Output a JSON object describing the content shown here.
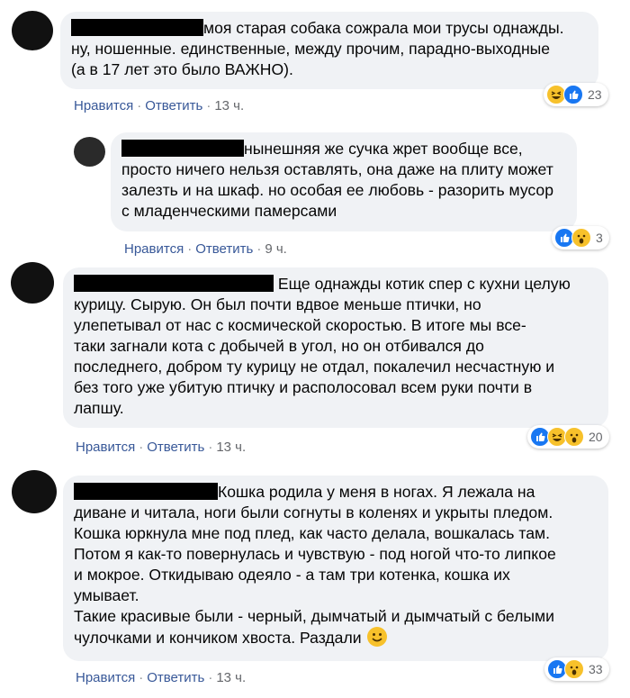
{
  "comments": [
    {
      "text_lines": [
        "моя старая собака сожрала мои трусы однажды.",
        "ну, ношенные. единственные, между прочим, парадно-выходные",
        "(а в 17 лет это было ВАЖНО)."
      ],
      "actions": {
        "like": "Нравится",
        "reply": "Ответить",
        "time": "13 ч."
      },
      "reactions": {
        "icons": [
          "haha-icon",
          "like-icon"
        ],
        "count": "23"
      }
    },
    {
      "text_lines": [
        "нынешняя же сучка жрет вообще все,",
        "просто ничего нельзя оставлять, она даже на плиту может",
        "залезть и на шкаф. но особая ее любовь - разорить мусор",
        "с младенческими памерсами"
      ],
      "actions": {
        "like": "Нравится",
        "reply": "Ответить",
        "time": "9 ч."
      },
      "reactions": {
        "icons": [
          "like-icon",
          "wow-icon"
        ],
        "count": "3"
      }
    },
    {
      "text_lines": [
        "Еще однажды котик спер с кухни целую",
        "курицу. Сырую. Он был почти вдвое меньше птички, но",
        "улепетывал от нас с космической скоростью. В итоге мы все-",
        "таки загнали кота с добычей в угол, но он отбивался до",
        "последнего, добром ту курицу не отдал, покалечил несчастную и",
        "без того уже убитую птичку и располосовал всем руки почти в",
        "лапшу."
      ],
      "actions": {
        "like": "Нравится",
        "reply": "Ответить",
        "time": "13 ч."
      },
      "reactions": {
        "icons": [
          "like-icon",
          "haha-icon",
          "wow-icon"
        ],
        "count": "20"
      }
    },
    {
      "text_lines": [
        "Кошка родила у меня в ногах. Я лежала на",
        "диване и читала, ноги были согнуты в коленях и укрыты пледом.",
        "Кошка юркнула мне под плед, как часто делала, вошкалась там.",
        "Потом я как-то повернулась и чувствую - под ногой что-то липкое",
        "и мокрое. Откидываю одеяло - а там три котенка, кошка их",
        "умывает.",
        "Такие красивые были - черный, дымчатый и дымчатый с белыми",
        "чулочками и кончиком хвоста. Раздали"
      ],
      "actions": {
        "like": "Нравится",
        "reply": "Ответить",
        "time": "13 ч."
      },
      "reactions": {
        "icons": [
          "like-icon",
          "wow-icon"
        ],
        "count": "33"
      }
    }
  ],
  "colors": {
    "bubble": "#f0f2f5",
    "link": "#385898",
    "like": "#1877f2",
    "emoji": "#f7c12b"
  }
}
